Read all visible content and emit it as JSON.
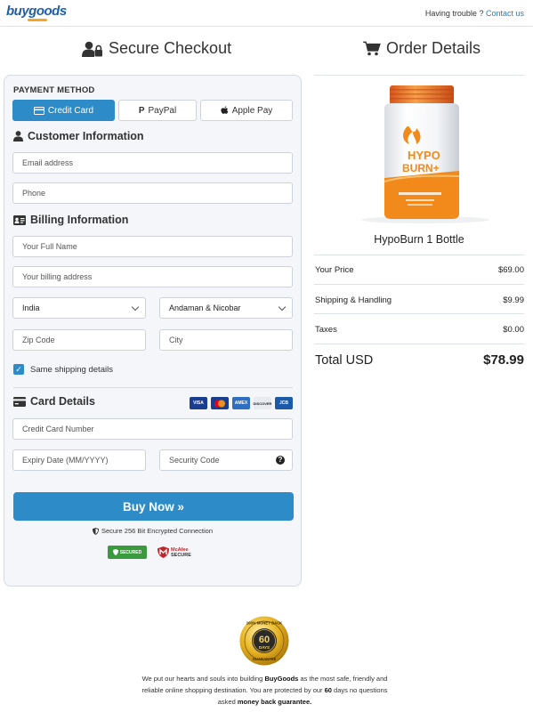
{
  "header": {
    "logo_text": "buygoods",
    "trouble_text": "Having trouble ?",
    "contact_link": "Contact us"
  },
  "left_title": "Secure Checkout",
  "right_title": "Order Details",
  "payment": {
    "label": "PAYMENT METHOD",
    "options": [
      "Credit Card",
      "PayPal",
      "Apple Pay"
    ],
    "selected": "Credit Card"
  },
  "customer": {
    "title": "Customer Information",
    "email_placeholder": "Email address",
    "phone_placeholder": "Phone"
  },
  "billing": {
    "title": "Billing Information",
    "name_placeholder": "Your Full Name",
    "address_placeholder": "Your billing address",
    "country_value": "India",
    "state_value": "Andaman & Nicobar",
    "zip_placeholder": "Zip Code",
    "city_placeholder": "City",
    "same_shipping_label": "Same shipping details",
    "same_shipping_checked": true
  },
  "card": {
    "title": "Card Details",
    "logos": [
      "VISA",
      "MC",
      "AMEX",
      "DISCOVER",
      "JCB"
    ],
    "number_placeholder": "Credit Card Number",
    "expiry_placeholder": "Expiry Date (MM/YYYY)",
    "cvv_placeholder": "Security Code"
  },
  "buy_button": "Buy Now »",
  "secure_text": "Secure 256 Bit Encrypted Connection",
  "badges": {
    "godaddy": "SECURED",
    "mcafee_1": "McAfee",
    "mcafee_2": "SECURE"
  },
  "order": {
    "product_name": "HypoBurn 1 Bottle",
    "product_brand_1": "HYPO",
    "product_brand_2": "BURN+",
    "rows": [
      {
        "label": "Your Price",
        "value": "$69.00"
      },
      {
        "label": "Shipping & Handling",
        "value": "$9.99"
      },
      {
        "label": "Taxes",
        "value": "$0.00"
      }
    ],
    "total_label": "Total USD",
    "total_value": "$78.99"
  },
  "footer": {
    "seal_top": "100% MONEY BACK",
    "seal_days": "60",
    "seal_days_label": "DAYS",
    "seal_bottom": "GUARANTEE",
    "text_1": "We put our hearts and souls into building ",
    "brand": "BuyGoods",
    "text_2": " as the most safe, friendly and reliable online shopping destination. You are protected by our ",
    "days": "60",
    "text_3": " days no questions asked ",
    "guarantee_bold": "money back guarantee."
  },
  "colors": {
    "accent": "#2d8bc7",
    "card_bg": "#f4f6f9",
    "link": "#1e7fc9",
    "product_orange": "#f28a1b"
  }
}
